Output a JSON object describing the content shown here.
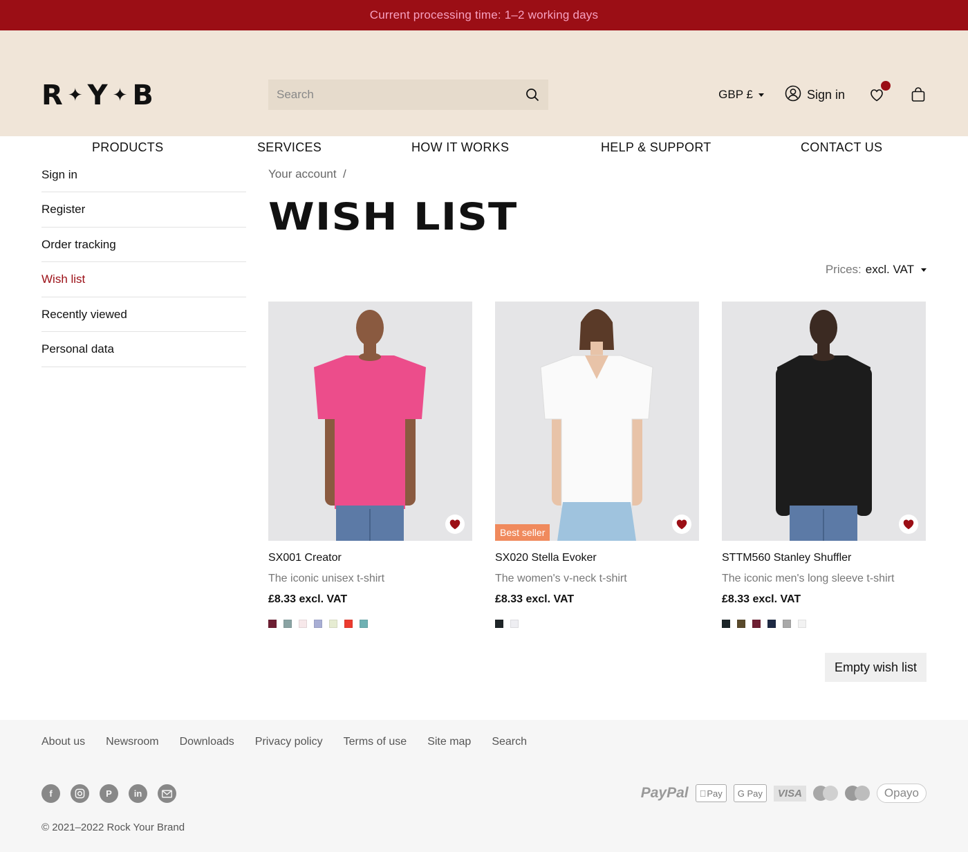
{
  "topbar": {
    "text": "Current processing time: 1–2 working days"
  },
  "header": {
    "logo": {
      "l1": "R",
      "l2": "Y",
      "l3": "B"
    },
    "search_placeholder": "Search",
    "currency": "GBP £",
    "signin": "Sign in",
    "nav": [
      "PRODUCTS",
      "SERVICES",
      "HOW IT WORKS",
      "HELP & SUPPORT",
      "CONTACT US"
    ]
  },
  "sidebar": [
    "Sign in",
    "Register",
    "Order tracking",
    "Wish list",
    "Recently viewed",
    "Personal data"
  ],
  "breadcrumb": "Your account  /",
  "page_title": "WISH LIST",
  "prices": {
    "label": "Prices:",
    "value": "excl. VAT"
  },
  "products": [
    {
      "name": "SX001 Creator",
      "desc": "The iconic unisex t-shirt",
      "price": "£8.33 excl. VAT",
      "badge": "",
      "shirt_color": "#ec4d8b",
      "swatches": [
        "#6e1f33",
        "#8aa3a3",
        "#f7e8ea",
        "#a8aed4",
        "#e6ecd2",
        "#ec3b2f",
        "#6fb1b3"
      ]
    },
    {
      "name": "SX020 Stella Evoker",
      "desc": "The women's v-neck t-shirt",
      "price": "£8.33 excl. VAT",
      "badge": "Best seller",
      "shirt_color": "#fafafa",
      "swatches": [
        "#1f2528",
        "#eeeef2"
      ]
    },
    {
      "name": "STTM560 Stanley Shuffler",
      "desc": "The iconic men's long sleeve t-shirt",
      "price": "£8.33 excl. VAT",
      "badge": "",
      "shirt_color": "#1c1c1c",
      "swatches": [
        "#1b2528",
        "#5a4a2c",
        "#6e1f33",
        "#1e2a44",
        "#a9a9a9",
        "#f2f2f2"
      ]
    }
  ],
  "empty_button": "Empty wish list",
  "footer": {
    "links": [
      "About us",
      "Newsroom",
      "Downloads",
      "Privacy policy",
      "Terms of use",
      "Site map",
      "Search"
    ],
    "social_icons": [
      "facebook-icon",
      "instagram-icon",
      "pinterest-icon",
      "linkedin-icon",
      "email-icon"
    ],
    "payments": {
      "paypal": "PayPal",
      "applepay": "Pay",
      "gpay": "G Pay",
      "visa": "VISA",
      "opayo": "Opayo"
    },
    "copyright": "© 2021–2022 Rock Your Brand"
  },
  "colors": {
    "brand": "#9b0e15",
    "header_bg": "#f0e5d8",
    "topbar_text": "#f7a0c0"
  }
}
